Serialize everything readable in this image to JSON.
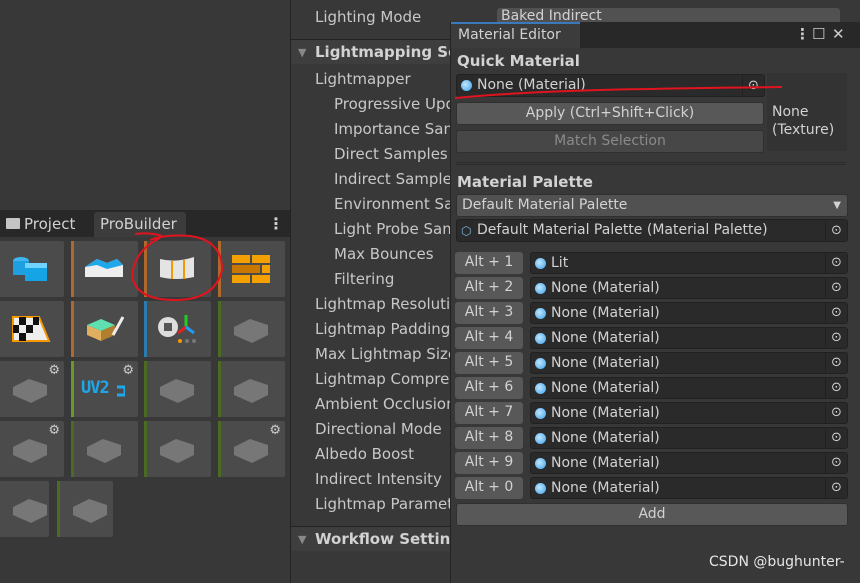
{
  "left_panel": {
    "tabs": [
      {
        "label": "Project",
        "icon": "folder-icon"
      },
      {
        "label": "ProBuilder"
      }
    ],
    "more_icon": "kebab-menu-icon",
    "tools": [
      {
        "name": "new-shape",
        "stripe": "none",
        "icon": "shapes-icon"
      },
      {
        "name": "new-poly-shape",
        "stripe": "#b0692d",
        "icon": "poly-shape-icon"
      },
      {
        "name": "smoothing",
        "stripe": "#b0692d",
        "icon": "smoothing-icon"
      },
      {
        "name": "material-editor",
        "stripe": "#b0692d",
        "icon": "bricks-icon"
      },
      {
        "name": "uv-editor",
        "stripe": "none",
        "icon": "uv-checker-icon"
      },
      {
        "name": "vertex-colors",
        "stripe": "#b0692d",
        "icon": "paint-icon"
      },
      {
        "name": "pivot",
        "stripe": "#2b7ab0",
        "icon": "globe-axes-icon"
      },
      {
        "name": "merge",
        "stripe": "#4c6b22",
        "icon": "merge-icon",
        "disabled": true
      },
      {
        "name": "flip-normals",
        "stripe": "none",
        "icon": "box-arrow-icon",
        "gear": true,
        "disabled": true
      },
      {
        "name": "lightmap-uvs",
        "stripe": "#6a9a24",
        "icon": "uv2-icon",
        "gear": true,
        "label": "UV2"
      },
      {
        "name": "conform-normals",
        "stripe": "#4c6b22",
        "icon": "fold-icon",
        "disabled": true
      },
      {
        "name": "center-pivot",
        "stripe": "#4c6b22",
        "icon": "box-center-icon",
        "disabled": true
      },
      {
        "name": "export",
        "stripe": "none",
        "icon": "box-points-icon",
        "gear": true,
        "disabled": true
      },
      {
        "name": "triangulate",
        "stripe": "#4c6b22",
        "icon": "grid-box-icon",
        "disabled": true
      },
      {
        "name": "subdivide",
        "stripe": "#4c6b22",
        "icon": "undo-shape-icon",
        "disabled": true
      },
      {
        "name": "mirror",
        "stripe": "#4c6b22",
        "icon": "mirror-icon",
        "gear": true,
        "disabled": true
      },
      {
        "name": "detach",
        "stripe": "none",
        "icon": "split-icon",
        "disabled": true
      },
      {
        "name": "collapse",
        "stripe": "#4c6b22",
        "icon": "collapse-icon",
        "disabled": true
      }
    ]
  },
  "inspector": {
    "lighting_mode_label": "Lighting Mode",
    "lighting_mode_value": "Baked Indirect",
    "lightmapping_header": "Lightmapping Settings",
    "rows": [
      {
        "label": "Lightmapper",
        "indent": false
      },
      {
        "label": "Progressive Updates",
        "indent": true
      },
      {
        "label": "Importance Sampling",
        "indent": true
      },
      {
        "label": "Direct Samples",
        "indent": true
      },
      {
        "label": "Indirect Samples",
        "indent": true
      },
      {
        "label": "Environment Samples",
        "indent": true
      },
      {
        "label": "Light Probe Sample Multiplier",
        "indent": true
      },
      {
        "label": "Max Bounces",
        "indent": true
      },
      {
        "label": "Filtering",
        "indent": true
      },
      {
        "label": "Lightmap Resolution",
        "indent": false
      },
      {
        "label": "Lightmap Padding",
        "indent": false
      },
      {
        "label": "Max Lightmap Size",
        "indent": false
      },
      {
        "label": "Lightmap Compression",
        "indent": false
      },
      {
        "label": "Ambient Occlusion",
        "indent": false
      },
      {
        "label": "Directional Mode",
        "indent": false
      },
      {
        "label": "Albedo Boost",
        "indent": false
      },
      {
        "label": "Indirect Intensity",
        "indent": false
      },
      {
        "label": "Lightmap Parameters",
        "indent": false
      }
    ],
    "workflow_header": "Workflow Settings"
  },
  "material_editor": {
    "title": "Material Editor",
    "quick_material": {
      "heading": "Quick Material",
      "material_field": "None (Material)",
      "apply_label": "Apply (Ctrl+Shift+Click)",
      "match_label": "Match Selection",
      "texture_preview": "None\n(Texture)"
    },
    "palette": {
      "heading": "Material Palette",
      "dropdown_value": "Default Material Palette",
      "asset_field": "Default Material Palette (Material Palette)",
      "slots": [
        {
          "shortcut": "Alt + 1",
          "material": "Lit"
        },
        {
          "shortcut": "Alt + 2",
          "material": "None (Material)"
        },
        {
          "shortcut": "Alt + 3",
          "material": "None (Material)"
        },
        {
          "shortcut": "Alt + 4",
          "material": "None (Material)"
        },
        {
          "shortcut": "Alt + 5",
          "material": "None (Material)"
        },
        {
          "shortcut": "Alt + 6",
          "material": "None (Material)"
        },
        {
          "shortcut": "Alt + 7",
          "material": "None (Material)"
        },
        {
          "shortcut": "Alt + 8",
          "material": "None (Material)"
        },
        {
          "shortcut": "Alt + 9",
          "material": "None (Material)"
        },
        {
          "shortcut": "Alt + 0",
          "material": "None (Material)"
        }
      ],
      "add_label": "Add"
    }
  },
  "watermark": "CSDN @bughunter-",
  "colors": {
    "accent": "#3a79bb",
    "annotation": "#e0141e"
  }
}
